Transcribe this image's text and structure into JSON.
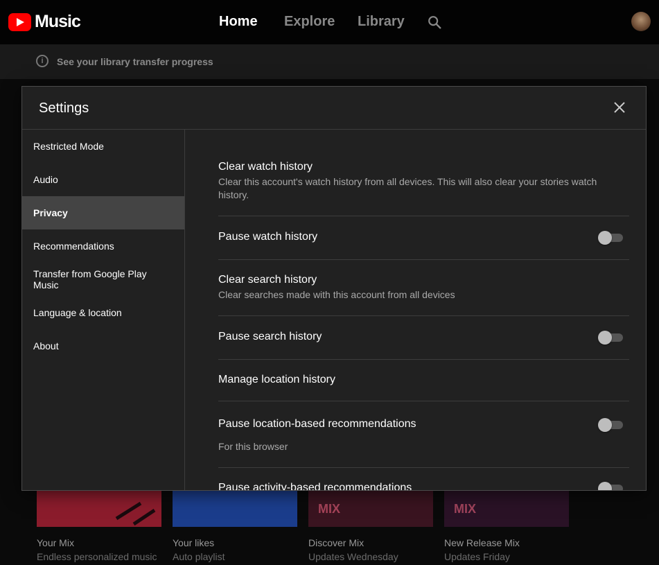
{
  "app": {
    "logo_text": "Music",
    "nav": {
      "home": "Home",
      "explore": "Explore",
      "library": "Library"
    },
    "notice": "See your library transfer progress"
  },
  "cards": [
    {
      "title": "Your Mix",
      "subtitle": "Endless personalized music",
      "color": "#8b1c2c"
    },
    {
      "title": "Your likes",
      "subtitle": "Auto playlist",
      "color": "#1b3d8c"
    },
    {
      "title": "Discover Mix",
      "subtitle": "Updates Wednesday",
      "color": "#3a1420",
      "badge": "MIX"
    },
    {
      "title": "New Release Mix",
      "subtitle": "Updates Friday",
      "color": "#2a1226",
      "badge": "MIX"
    }
  ],
  "modal": {
    "title": "Settings",
    "sidebar": [
      {
        "label": "Restricted Mode"
      },
      {
        "label": "Audio"
      },
      {
        "label": "Privacy",
        "active": true
      },
      {
        "label": "Recommendations"
      },
      {
        "label": "Transfer from Google Play Music"
      },
      {
        "label": "Language & location"
      },
      {
        "label": "About"
      }
    ],
    "privacy": {
      "clear_watch": {
        "title": "Clear watch history",
        "desc": "Clear this account's watch history from all devices. This will also clear your stories watch history."
      },
      "pause_watch": {
        "title": "Pause watch history",
        "enabled": false
      },
      "clear_search": {
        "title": "Clear search history",
        "desc": "Clear searches made with this account from all devices"
      },
      "pause_search": {
        "title": "Pause search history",
        "enabled": false
      },
      "manage_location": {
        "title": "Manage location history"
      },
      "pause_location_recs": {
        "title": "Pause location-based recommendations",
        "desc": "For this browser",
        "enabled": false
      },
      "pause_activity_recs": {
        "title": "Pause activity-based recommendations",
        "enabled": false
      }
    }
  },
  "colors": {
    "accent": "#ff0000",
    "background": "#030303",
    "modal": "#212121",
    "active_item": "#444444"
  }
}
